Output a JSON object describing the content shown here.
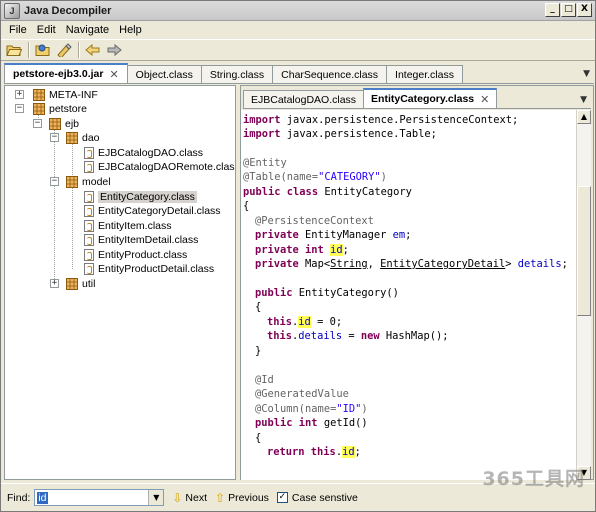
{
  "window": {
    "title": "Java Decompiler",
    "icon": "java-decompiler-app-icon",
    "buttons": [
      "_",
      "□",
      "X"
    ]
  },
  "menubar": {
    "items": [
      "File",
      "Edit",
      "Navigate",
      "Help"
    ]
  },
  "toolbar": {
    "icons": [
      "open-file-icon",
      "open-type-icon",
      "open-type-hierarchy-icon",
      "back-arrow-icon",
      "forward-arrow-icon"
    ]
  },
  "outer_tabs": [
    {
      "label": "petstore-ejb3.0.jar",
      "active": true,
      "close": "✕"
    },
    {
      "label": "Object.class"
    },
    {
      "label": "String.class"
    },
    {
      "label": "CharSequence.class"
    },
    {
      "label": "Integer.class"
    }
  ],
  "tree": {
    "meta_inf": "META-INF",
    "petstore": "petstore",
    "ejb": "ejb",
    "dao": "dao",
    "dao_items": [
      "EJBCatalogDAO.class",
      "EJBCatalogDAORemote.class"
    ],
    "model": "model",
    "model_items": [
      "EntityCategory.class",
      "EntityCategoryDetail.class",
      "EntityItem.class",
      "EntityItemDetail.class",
      "EntityProduct.class",
      "EntityProductDetail.class"
    ],
    "selected": "EntityCategory.class",
    "util": "util"
  },
  "inner_tabs": [
    {
      "label": "EJBCatalogDAO.class"
    },
    {
      "label": "EntityCategory.class",
      "active": true,
      "close": "✕"
    }
  ],
  "code": {
    "l1_kw": "import",
    "l1_rest": " javax.persistence.PersistenceContext;",
    "l2_kw": "import",
    "l2_rest": " javax.persistence.Table;",
    "l4_ann": "@Entity",
    "l5_ann": "@Table(name=",
    "l5_str": "\"CATEGORY\"",
    "l5_end": ")",
    "l6_kw": "public class",
    "l6_rest": " EntityCategory",
    "l7": "{",
    "l8_ann": "@PersistenceContext",
    "l9_kw": "private",
    "l9_rest": " EntityManager ",
    "l9_fld": "em",
    "l9_end": ";",
    "l10_kw": "private int",
    "l10_fld": "id",
    "l10_end": ";",
    "l11_kw": "private",
    "l11_a": " Map<",
    "l11_b": "String",
    "l11_c": ", ",
    "l11_d": "EntityCategoryDetail",
    "l11_e": "> ",
    "l11_fld": "details",
    "l11_end": ";",
    "l13_kw": "public",
    "l13_rest": " EntityCategory()",
    "l14": "{",
    "l15_kw": "this",
    "l15_dot": ".",
    "l15_fld": "id",
    "l15_rest": " = 0;",
    "l16_kw": "this",
    "l16_dot": ".",
    "l16_fld": "details",
    "l16_eq": " = ",
    "l16_kw2": "new",
    "l16_rest": " HashMap();",
    "l17": "}",
    "l19_ann": "@Id",
    "l20_ann": "@GeneratedValue",
    "l21_ann": "@Column(name=",
    "l21_str": "\"ID\"",
    "l21_end": ")",
    "l22_kw": "public int",
    "l22_rest": " getId()",
    "l23": "{",
    "l24_kw": "return this",
    "l24_dot": ".",
    "l24_fld": "id",
    "l24_end": ";"
  },
  "findbar": {
    "label": "Find:",
    "value": "id",
    "next": "Next",
    "previous": "Previous",
    "case_sensitive": "Case senstive",
    "case_checked": "✓"
  },
  "watermark": "365工具网"
}
